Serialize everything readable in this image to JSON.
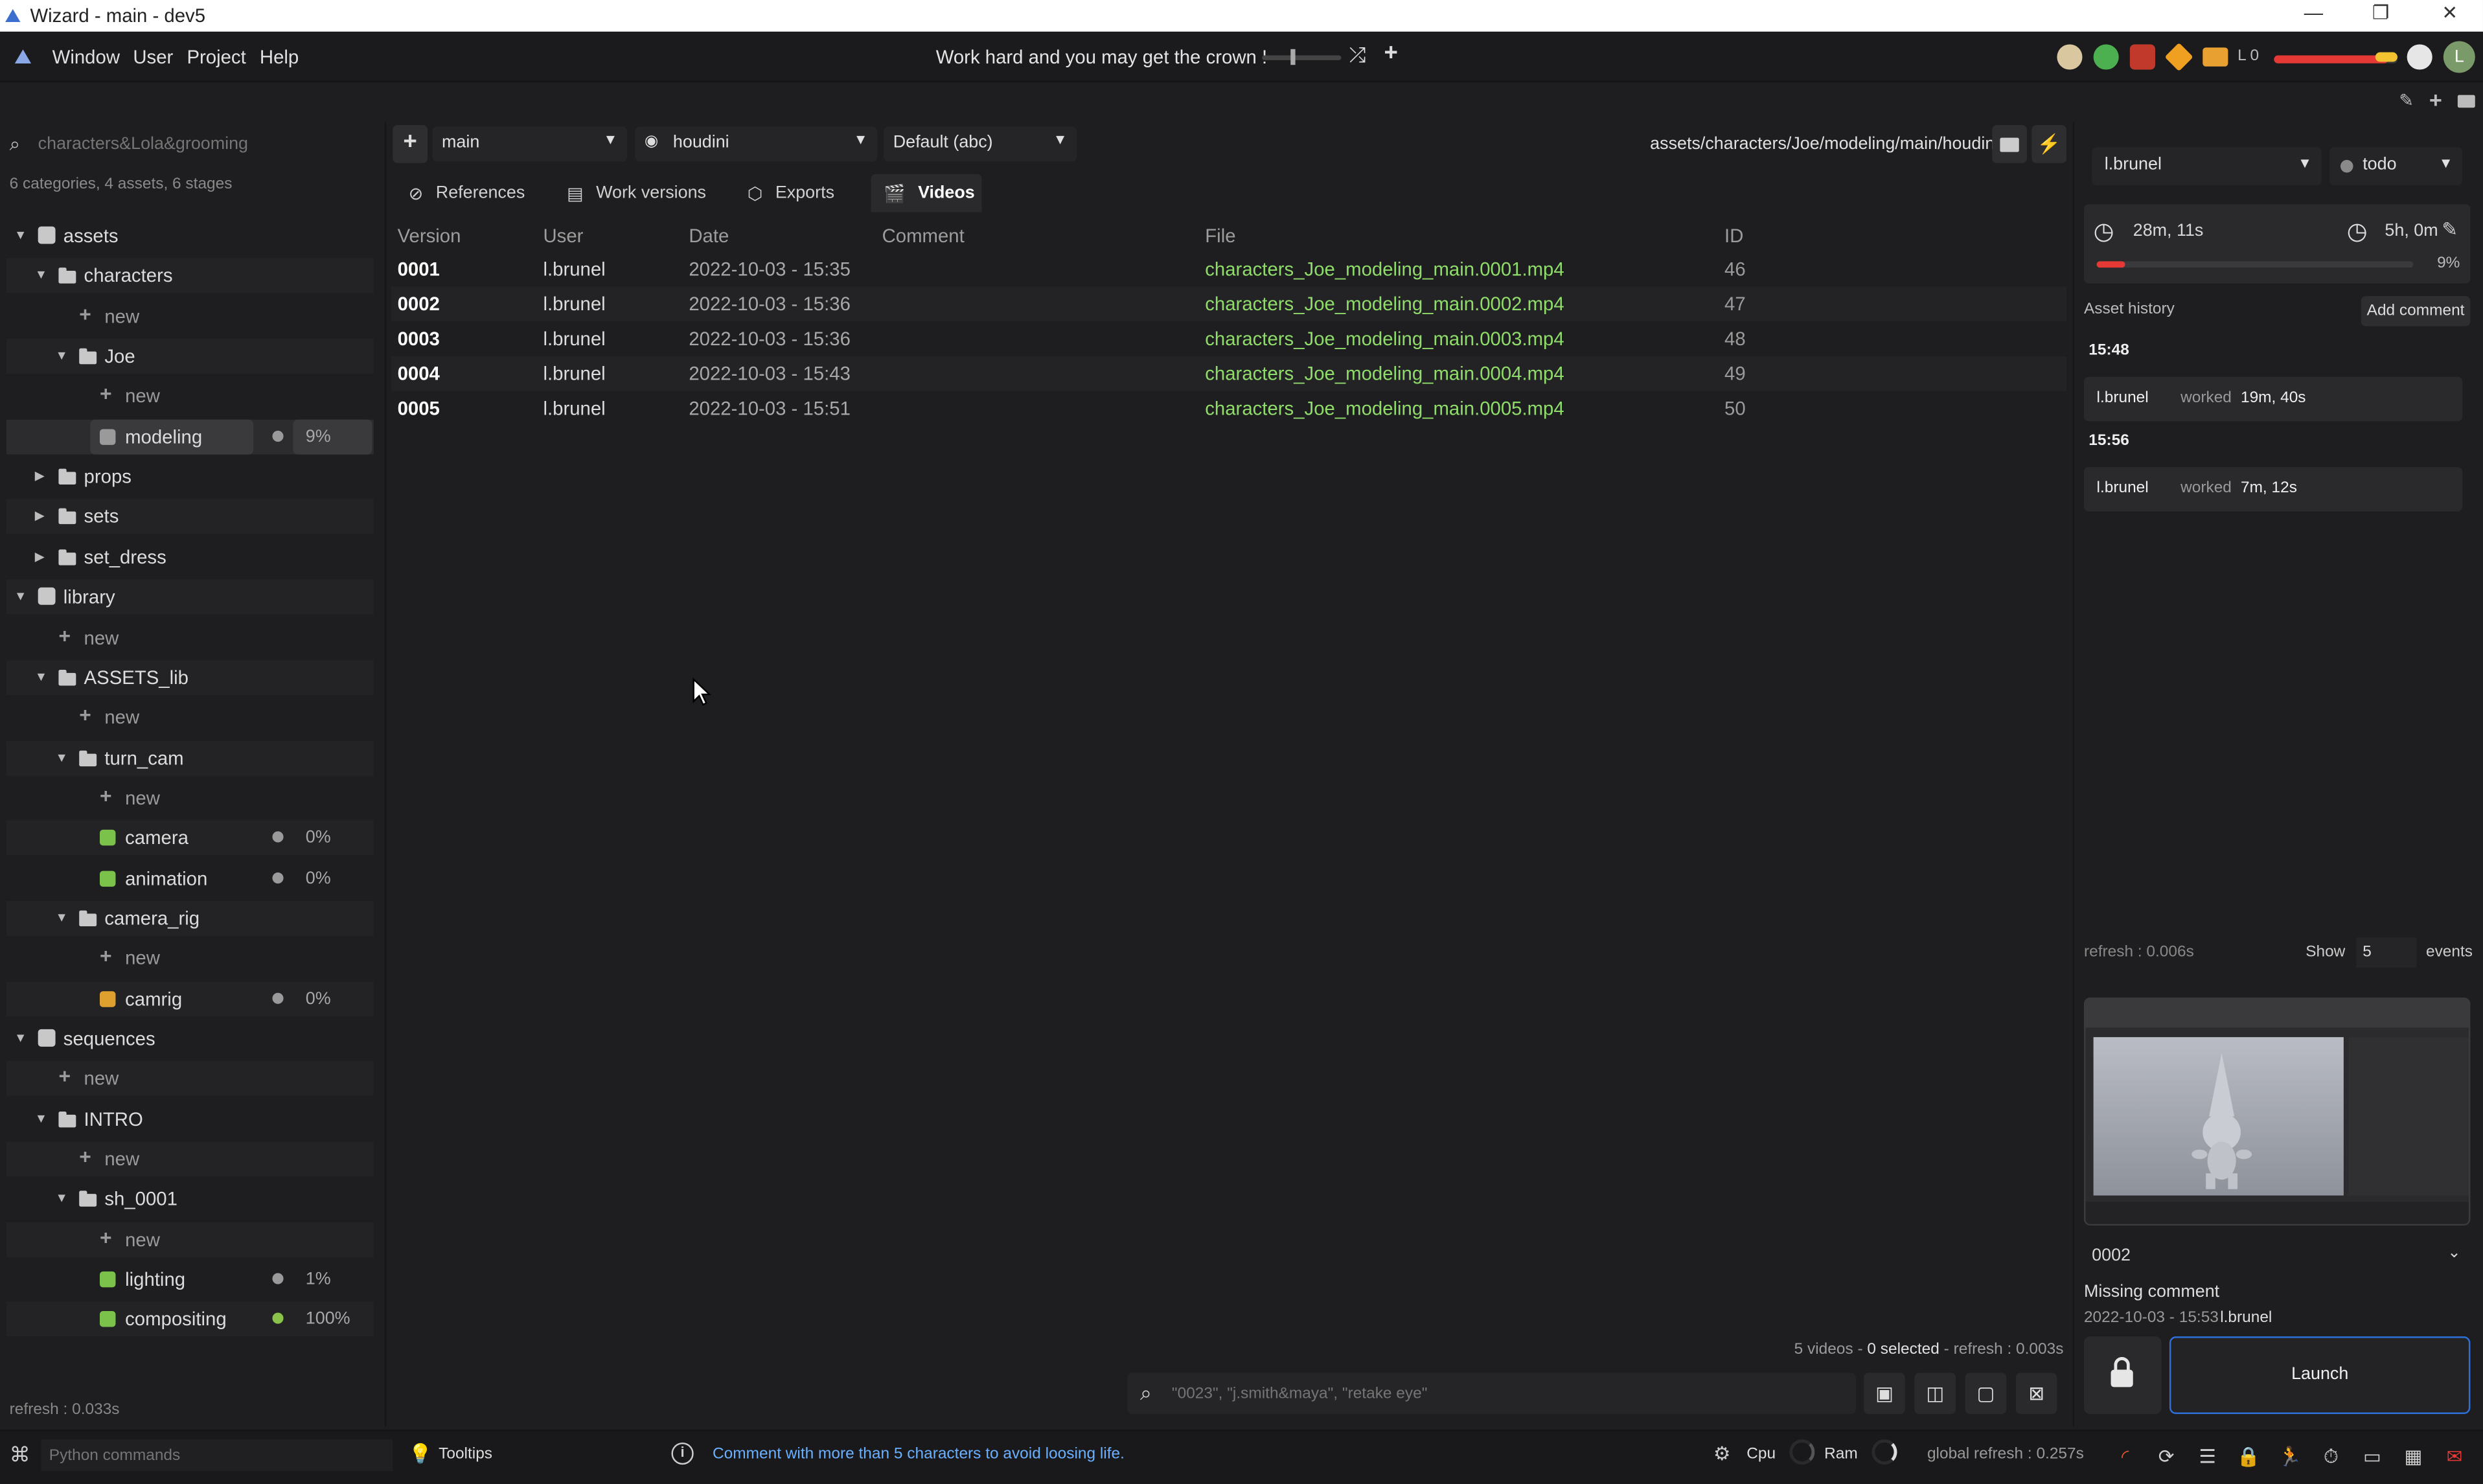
{
  "window": {
    "title": "Wizard - main - dev5",
    "controls": [
      "—",
      "❐",
      "✕"
    ]
  },
  "menu": {
    "items": [
      "Window",
      "User",
      "Project",
      "Help"
    ],
    "motto": "Work hard and you may get the crown !",
    "level": "L 0",
    "avatar_letter": "L",
    "life_fraction": 0.92
  },
  "left": {
    "search_placeholder": "characters&Lola&grooming",
    "summary": "6 categories, 4 assets, 6 stages",
    "refresh": "refresh : 0.033s",
    "tree": [
      {
        "label": "assets",
        "kind": "domain",
        "depth": 0,
        "expanded": true
      },
      {
        "label": "characters",
        "kind": "folder",
        "depth": 1,
        "expanded": true
      },
      {
        "label": "new",
        "kind": "new",
        "depth": 2
      },
      {
        "label": "Joe",
        "kind": "folder",
        "depth": 2,
        "expanded": true
      },
      {
        "label": "new",
        "kind": "new",
        "depth": 3
      },
      {
        "label": "modeling",
        "kind": "stage",
        "depth": 3,
        "pct": "9%",
        "selected": true,
        "icon_color": "#9a9a9a"
      },
      {
        "label": "props",
        "kind": "folder",
        "depth": 1,
        "expanded": false
      },
      {
        "label": "sets",
        "kind": "folder",
        "depth": 1,
        "expanded": false
      },
      {
        "label": "set_dress",
        "kind": "folder",
        "depth": 1,
        "expanded": false
      },
      {
        "label": "library",
        "kind": "domain",
        "depth": 0,
        "expanded": true
      },
      {
        "label": "new",
        "kind": "new",
        "depth": 1
      },
      {
        "label": "ASSETS_lib",
        "kind": "folder",
        "depth": 1,
        "expanded": true
      },
      {
        "label": "new",
        "kind": "new",
        "depth": 2
      },
      {
        "label": "turn_cam",
        "kind": "folder",
        "depth": 2,
        "expanded": true
      },
      {
        "label": "new",
        "kind": "new",
        "depth": 3
      },
      {
        "label": "camera",
        "kind": "stage",
        "depth": 3,
        "pct": "0%",
        "icon_color": "#7bc24a"
      },
      {
        "label": "animation",
        "kind": "stage",
        "depth": 3,
        "pct": "0%",
        "icon_color": "#7bc24a"
      },
      {
        "label": "camera_rig",
        "kind": "folder",
        "depth": 2,
        "expanded": true
      },
      {
        "label": "new",
        "kind": "new",
        "depth": 3
      },
      {
        "label": "camrig",
        "kind": "stage",
        "depth": 3,
        "pct": "0%",
        "icon_color": "#e0a030"
      },
      {
        "label": "sequences",
        "kind": "domain",
        "depth": 0,
        "expanded": true
      },
      {
        "label": "new",
        "kind": "new",
        "depth": 1
      },
      {
        "label": "INTRO",
        "kind": "folder",
        "depth": 1,
        "expanded": true
      },
      {
        "label": "new",
        "kind": "new",
        "depth": 2
      },
      {
        "label": "sh_0001",
        "kind": "folder",
        "depth": 2,
        "expanded": true
      },
      {
        "label": "new",
        "kind": "new",
        "depth": 3
      },
      {
        "label": "lighting",
        "kind": "stage",
        "depth": 3,
        "pct": "1%",
        "icon_color": "#7bc24a"
      },
      {
        "label": "compositing",
        "kind": "stage",
        "depth": 3,
        "pct": "100%",
        "icon_color": "#7bc24a",
        "dot_color": "#8bc34a"
      }
    ]
  },
  "center": {
    "variant": "main",
    "software": "houdini",
    "export_format": "Default (abc)",
    "path": "assets/characters/Joe/modeling/main/houdini",
    "tabs": [
      "References",
      "Work versions",
      "Exports",
      "Videos"
    ],
    "active_tab": "Videos",
    "columns": [
      "Version",
      "User",
      "Date",
      "Comment",
      "File",
      "ID"
    ],
    "rows": [
      {
        "version": "0001",
        "user": "l.brunel",
        "date": "2022-10-03 - 15:35",
        "comment": "",
        "file": "characters_Joe_modeling_main.0001.mp4",
        "id": "46"
      },
      {
        "version": "0002",
        "user": "l.brunel",
        "date": "2022-10-03 - 15:36",
        "comment": "",
        "file": "characters_Joe_modeling_main.0002.mp4",
        "id": "47"
      },
      {
        "version": "0003",
        "user": "l.brunel",
        "date": "2022-10-03 - 15:36",
        "comment": "",
        "file": "characters_Joe_modeling_main.0003.mp4",
        "id": "48"
      },
      {
        "version": "0004",
        "user": "l.brunel",
        "date": "2022-10-03 - 15:43",
        "comment": "",
        "file": "characters_Joe_modeling_main.0004.mp4",
        "id": "49"
      },
      {
        "version": "0005",
        "user": "l.brunel",
        "date": "2022-10-03 - 15:51",
        "comment": "",
        "file": "characters_Joe_modeling_main.0005.mp4",
        "id": "50"
      }
    ],
    "footer": {
      "count": "5 videos - ",
      "selected": "0 selected",
      "refresh": " - refresh : 0.003s"
    },
    "search_placeholder": "\"0023\", \"j.smith&maya\", \"retake eye\""
  },
  "right": {
    "user": "l.brunel",
    "state": "todo",
    "work_time": "28m, 11s",
    "estimated_time": "5h, 0m",
    "progress": "9%",
    "progress_fraction": 0.09,
    "history_title": "Asset history",
    "add_comment": "Add comment",
    "events": [
      {
        "time": "15:48",
        "user": "l.brunel",
        "verb": "worked",
        "duration": "19m, 40s"
      },
      {
        "time": "15:56",
        "user": "l.brunel",
        "verb": "worked",
        "duration": "7m, 12s"
      }
    ],
    "refresh": "refresh : 0.006s",
    "show_label": "Show",
    "show_value": "5",
    "events_label": "events",
    "selected_version": "0002",
    "missing_comment": "Missing comment",
    "version_date": "2022-10-03 - 15:53",
    "version_user": "l.brunel",
    "launch": "Launch"
  },
  "statusbar": {
    "python_placeholder": "Python commands",
    "tooltips": "Tooltips",
    "info": "Comment with more than 5 characters to avoid loosing life.",
    "cpu": "Cpu",
    "ram": "Ram",
    "global_refresh": "global refresh : 0.257s"
  },
  "colors": {
    "accent": "#8fdc6a",
    "life": "#e53935",
    "launch_border": "#2f6fd8",
    "info": "#6ab0ff"
  }
}
